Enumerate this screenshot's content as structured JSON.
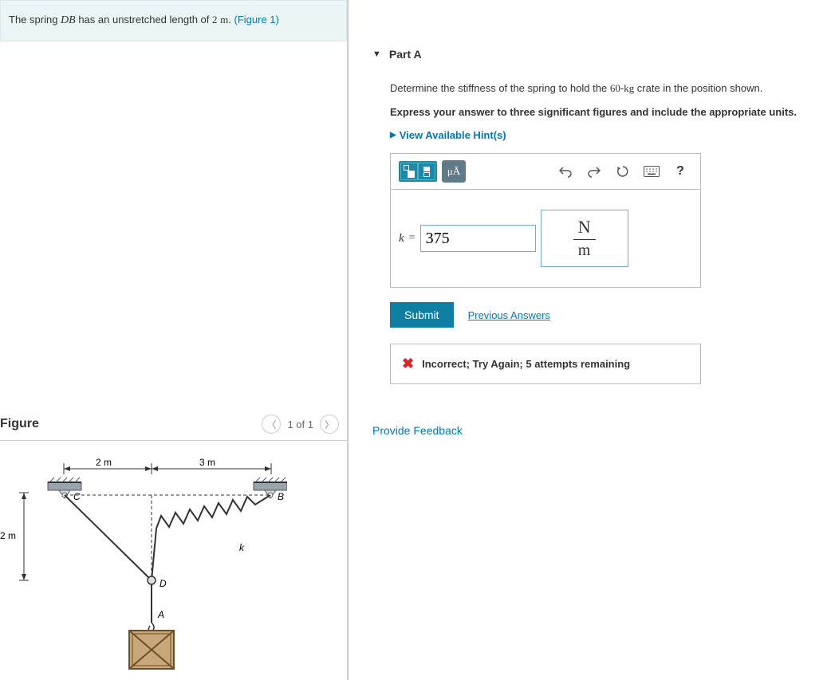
{
  "problem": {
    "text_pre": "The spring ",
    "variable": "DB",
    "text_mid": " has an unstretched length of ",
    "value": "2",
    "unit": "m",
    "text_post": ". ",
    "figure_ref": "(Figure 1)"
  },
  "figure": {
    "title": "Figure",
    "pager": "1 of 1",
    "labels": {
      "dim_top_left": "2 m",
      "dim_top_right": "3 m",
      "dim_left": "2 m",
      "point_C": "C",
      "point_B": "B",
      "point_D": "D",
      "point_A": "A",
      "spring": "k"
    }
  },
  "part": {
    "title": "Part A",
    "prompt_pre": "Determine the stiffness of the spring to hold the ",
    "prompt_val": "60",
    "prompt_unit_pre": "-",
    "prompt_unit": "kg",
    "prompt_post": " crate in the position shown.",
    "bold_prompt": "Express your answer to three significant figures and include the appropriate units.",
    "hints_label": "View Available Hint(s)",
    "toolbar": {
      "units_btn": "μÅ"
    },
    "answer": {
      "var": "k",
      "eq": "=",
      "value": "375",
      "unit_num": "N",
      "unit_den": "m"
    },
    "submit_label": "Submit",
    "prev_answers_label": "Previous Answers",
    "feedback": "Incorrect; Try Again; 5 attempts remaining"
  },
  "provide_feedback": "Provide Feedback"
}
